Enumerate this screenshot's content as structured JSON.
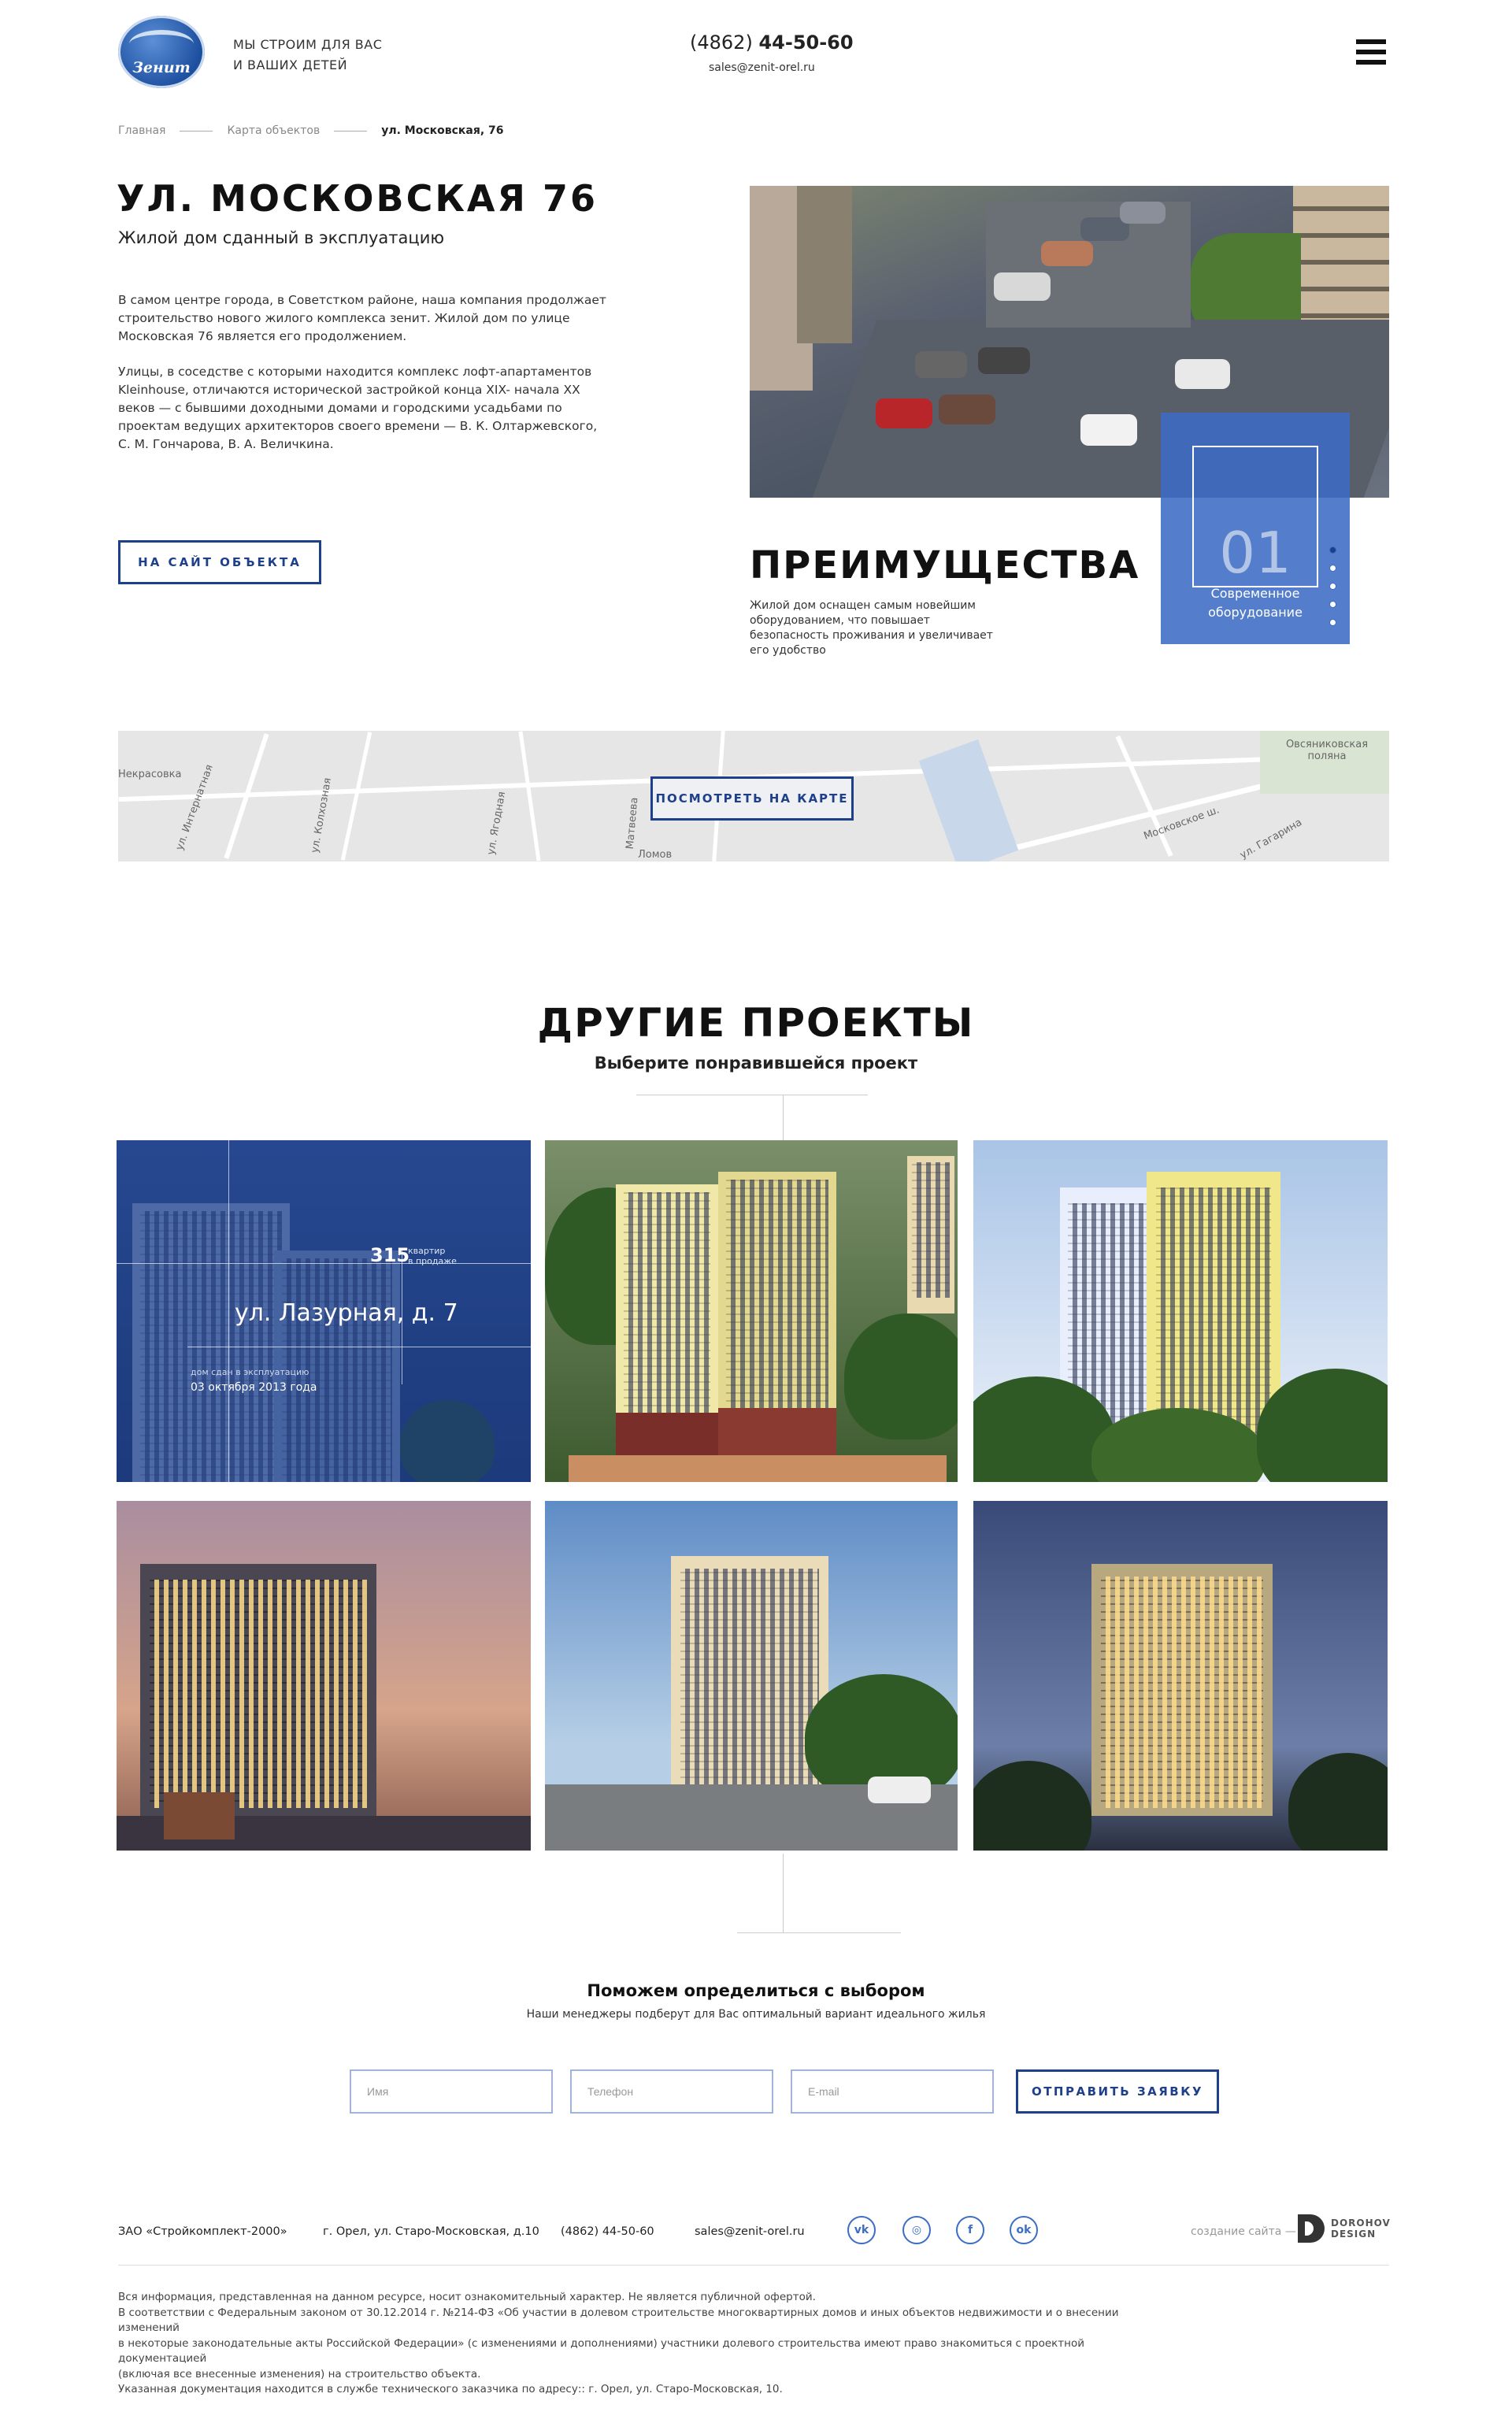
{
  "header": {
    "logo_text": "Зенит",
    "tagline_line1": "МЫ СТРОИМ ДЛЯ ВАС",
    "tagline_line2": "И ВАШИХ ДЕТЕЙ",
    "phone_code": "(4862)",
    "phone_number": "44-50-60",
    "email": "sales@zenit-orel.ru",
    "menu_icon": "hamburger-icon"
  },
  "breadcrumb": {
    "items": [
      "Главная",
      "Карта объектов",
      "ул. Московская, 76"
    ]
  },
  "hero": {
    "title": "УЛ. МОСКОВСКАЯ 76",
    "subtitle": "Жилой дом сданный в эксплуатацию",
    "paragraph1": "В самом центре города, в Советстком районе, наша компания продолжает строительство нового жилого комплекса зенит. Жилой дом по улице Московская 76 является его продолжением.",
    "paragraph2": "Улицы, в соседстве с которыми находится комплекс лофт-апартаментов Kleinhouse, отличаются исторической застройкой конца XIX- начала XX веков — с бывшими доходными домами и городскими усадьбами по проектам ведущих архитекторов своего времени — В. К. Олтаржевского, С. М. Гончарова, В. А. Величкина.",
    "site_button": "НА САЙТ ОБЪЕКТА"
  },
  "advantages": {
    "title": "ПРЕИМУЩЕСТВА",
    "text": "Жилой дом оснащен самым новейшим оборудованием, что повышает безопасность проживания и увеличивает его удобство",
    "number": "01",
    "caption_line1": "Современное",
    "caption_line2": "оборудование",
    "slides_total": 5,
    "active_slide": 1
  },
  "map": {
    "button": "ПОСМОТРЕТЬ НА КАРТЕ",
    "labels": [
      "Некрасовка",
      "ул. Интернатная",
      "ул. Колхозная",
      "ул. Ягодная",
      "Матвеева",
      "Ломов",
      "Овсяниковская поляна",
      "Московское ш.",
      "ул. Гагарина"
    ]
  },
  "other_projects": {
    "title": "ДРУГИЕ ПРОЕКТЫ",
    "subtitle": "Выберите понравившейся проект",
    "featured": {
      "count": "315",
      "count_label_line1": "квартир",
      "count_label_line2": "в продаже",
      "name": "ул. Лазурная, д. 7",
      "date_label": "дом сдан в эксплуатацию",
      "date": "03 октября 2013 года"
    }
  },
  "consult": {
    "title": "Поможем определиться с выбором",
    "subtitle": "Наши менеджеры подберут для Вас оптимальный вариант идеального жилья",
    "name_placeholder": "Имя",
    "phone_placeholder": "Телефон",
    "email_placeholder": "E-mail",
    "submit": "ОТПРАВИТЬ ЗАЯВКУ"
  },
  "footer": {
    "company": "ЗАО «Стройкомплект-2000»",
    "address": "г. Орел, ул. Старо-Московская, д.10",
    "phone": "(4862) 44-50-60",
    "email": "sales@zenit-orel.ru",
    "social": [
      "vk-icon",
      "instagram-icon",
      "facebook-icon",
      "odnoklassniki-icon"
    ],
    "made_by": "создание сайта —",
    "studio_line1": "DOROHOV",
    "studio_line2": "DESIGN",
    "legal_line1": "Вся информация, представленная на данном ресурсе, носит ознакомительный характер. Не является публичной офертой.",
    "legal_line2": "В соответствии с Федеральным законом от 30.12.2014 г. №214-ФЗ «Об участии в долевом строительстве многоквартирных домов и иных объектов недвижимости и о внесении изменений",
    "legal_line3": "в некоторые законодательные акты Российской Федерации» (с изменениями и дополнениями) участники долевого строительства имеют право знакомиться с проектной документацией",
    "legal_line4": "(включая все внесенные изменения) на строительство объекта.",
    "legal_line5": "Указанная документация находится в службе технического заказчика по адресу:: г. Орел, ул. Старо-Московская, 10."
  },
  "colors": {
    "accent": "#1e3f8a",
    "accent_light": "#3c6cc4"
  }
}
